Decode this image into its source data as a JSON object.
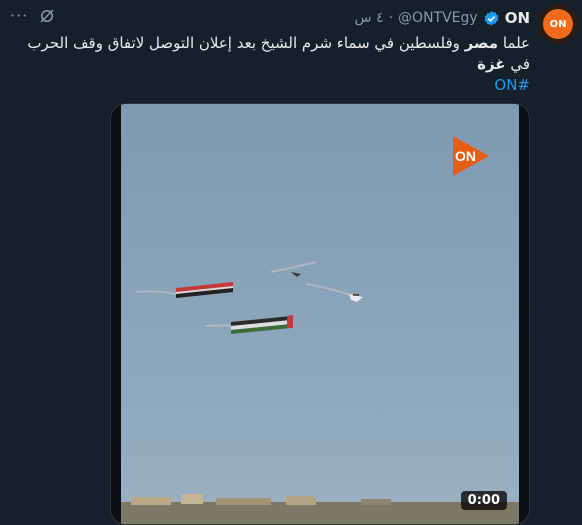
{
  "tweet": {
    "display_name": "ON",
    "handle": "@ONTVEgy",
    "separator": "·",
    "time": "٤ س",
    "menu_label": "···",
    "avatar_text": "ON",
    "text": {
      "part1": "علما ",
      "bold1": "مصر",
      "part2": " وفلسطين في سماء شرم الشيخ بعد إعلان التوصل لاتفاق وقف الحرب في ",
      "bold2": "غزة",
      "hashtag": "#ON"
    },
    "media": {
      "duration": "0:00",
      "logo_text": "ON"
    }
  },
  "colors": {
    "background": "#15202b",
    "verified": "#1d9bf0",
    "hashtag": "#1d9bf0",
    "brand": "#f26a1b"
  }
}
